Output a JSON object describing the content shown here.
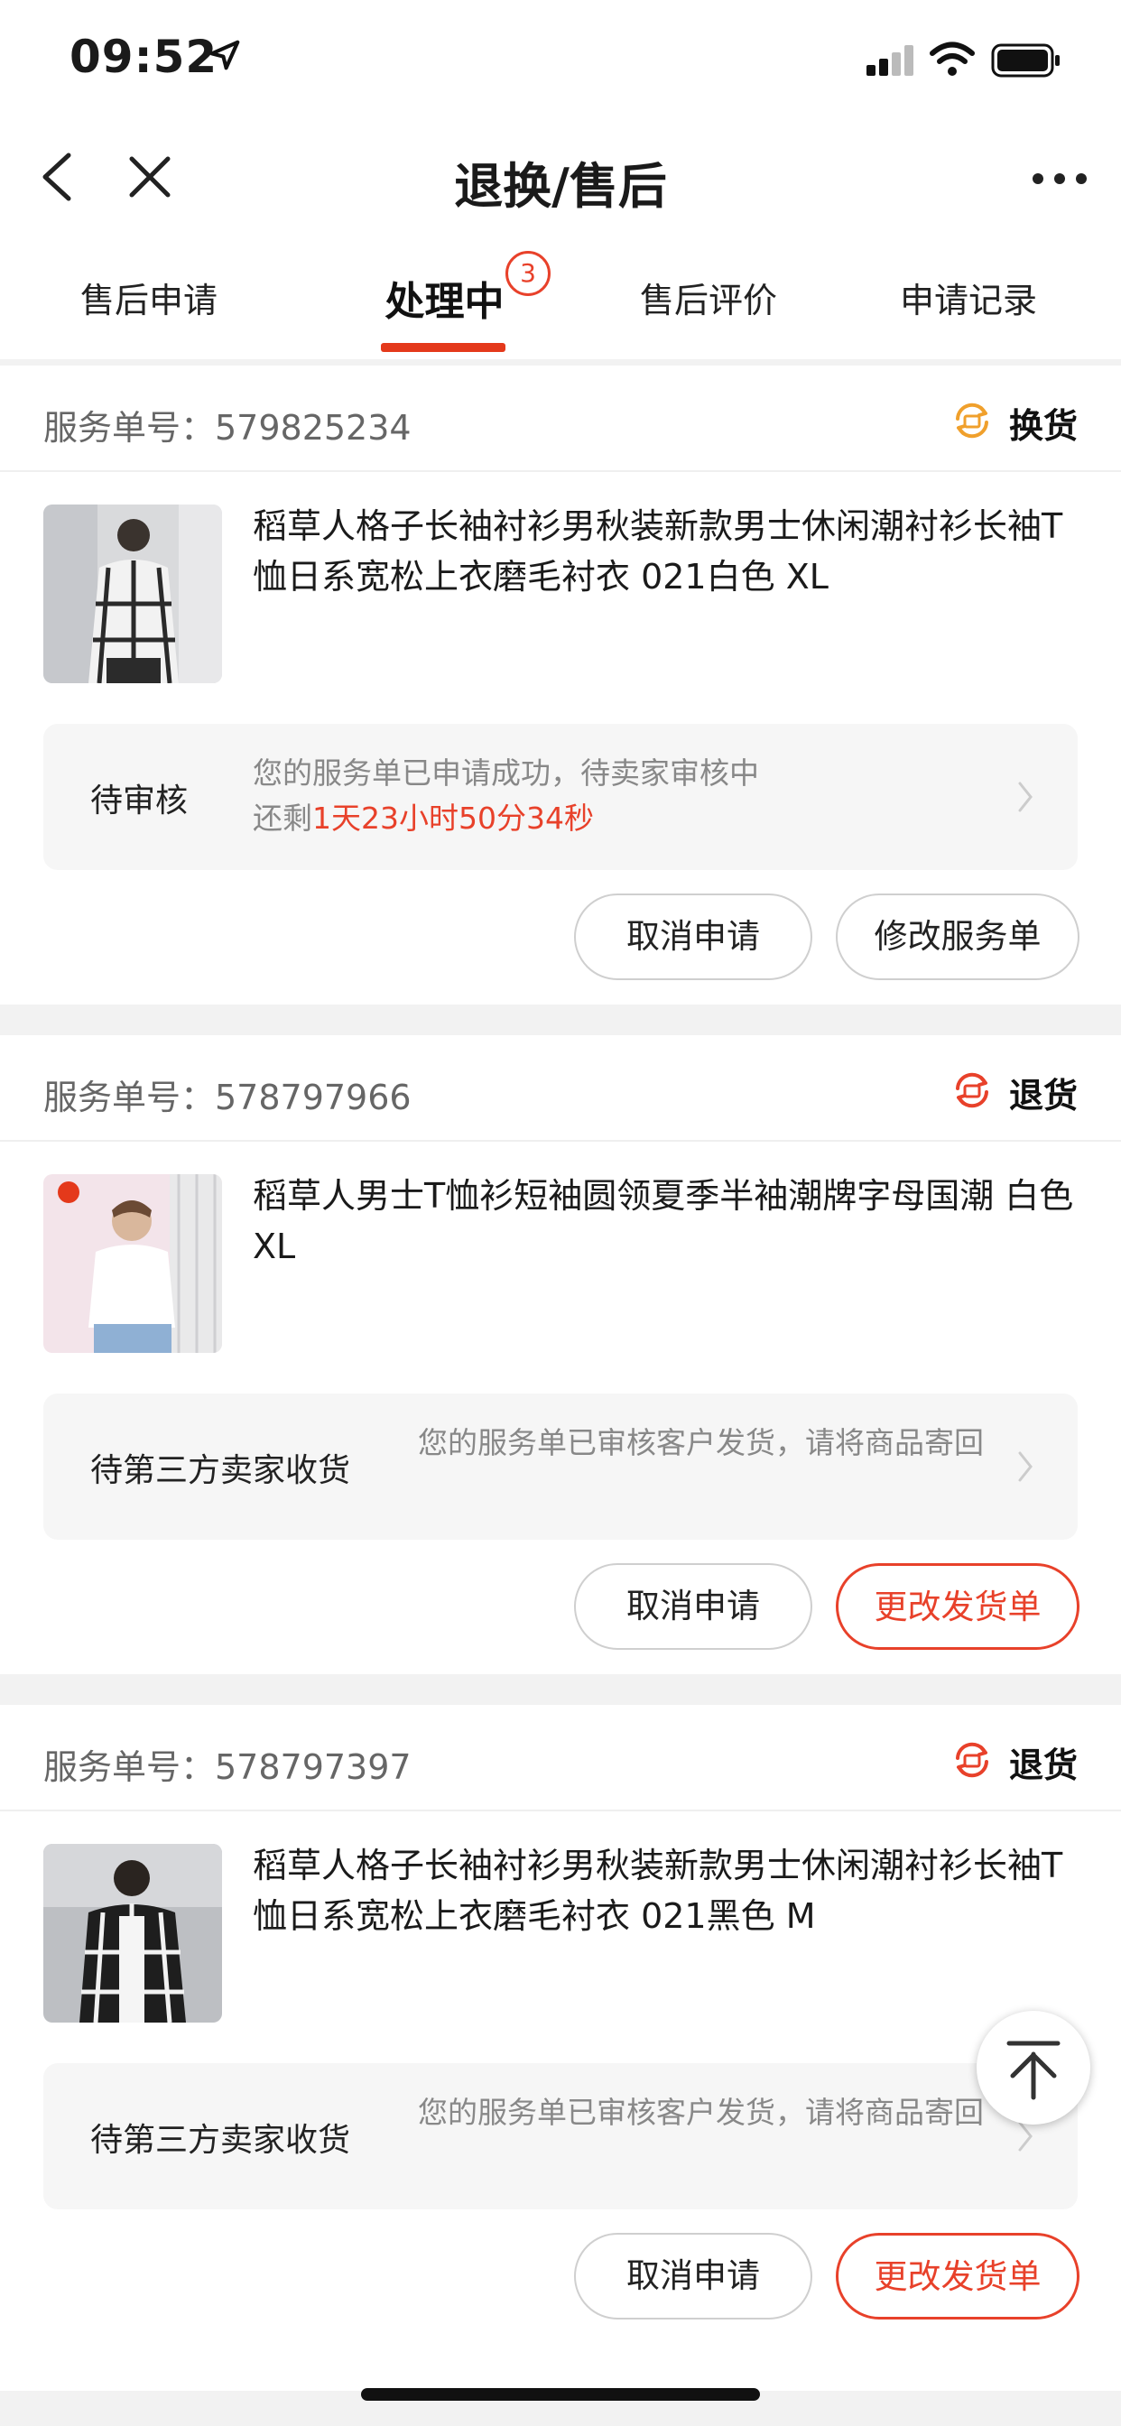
{
  "status_bar": {
    "time": "09:52"
  },
  "nav": {
    "title": "退换/售后"
  },
  "tabs": [
    {
      "label": "售后申请"
    },
    {
      "label": "处理中",
      "badge": "3",
      "active": true
    },
    {
      "label": "售后评价"
    },
    {
      "label": "申请记录"
    }
  ],
  "orders": [
    {
      "service_label": "服务单号：579825234",
      "type": "换货",
      "type_color": "#f0a02c",
      "product_title": "稻草人格子长袖衬衫男秋装新款男士休闲潮衬衫长袖T恤日系宽松上衣磨毛衬衣 021白色 XL",
      "status": "待审核",
      "message": "您的服务单已申请成功，待卖家审核中",
      "remaining_prefix": "还剩",
      "countdown": "1天23小时50分34秒",
      "buttons": [
        "取消申请",
        "修改服务单"
      ]
    },
    {
      "service_label": "服务单号：578797966",
      "type": "退货",
      "type_color": "#e8412a",
      "product_title": "稻草人男士T恤衫短袖圆领夏季半袖潮牌字母国潮 白色 XL",
      "status": "待第三方卖家收货",
      "message": "您的服务单已审核客户发货，请将商品寄回",
      "buttons": [
        "取消申请",
        "更改发货单"
      ]
    },
    {
      "service_label": "服务单号：578797397",
      "type": "退货",
      "type_color": "#e8412a",
      "product_title": "稻草人格子长袖衬衫男秋装新款男士休闲潮衬衫长袖T恤日系宽松上衣磨毛衬衣 021黑色 M",
      "status": "待第三方卖家收货",
      "message": "您的服务单已审核客户发货，请将商品寄回",
      "buttons": [
        "取消申请",
        "更改发货单"
      ]
    }
  ],
  "colors": {
    "accent": "#e8412a",
    "exchange": "#f0a02c"
  },
  "icons": [
    "back-icon",
    "close-icon",
    "more-icon",
    "exchange-icon",
    "return-icon",
    "chevron-right-icon",
    "back-to-top-icon"
  ]
}
